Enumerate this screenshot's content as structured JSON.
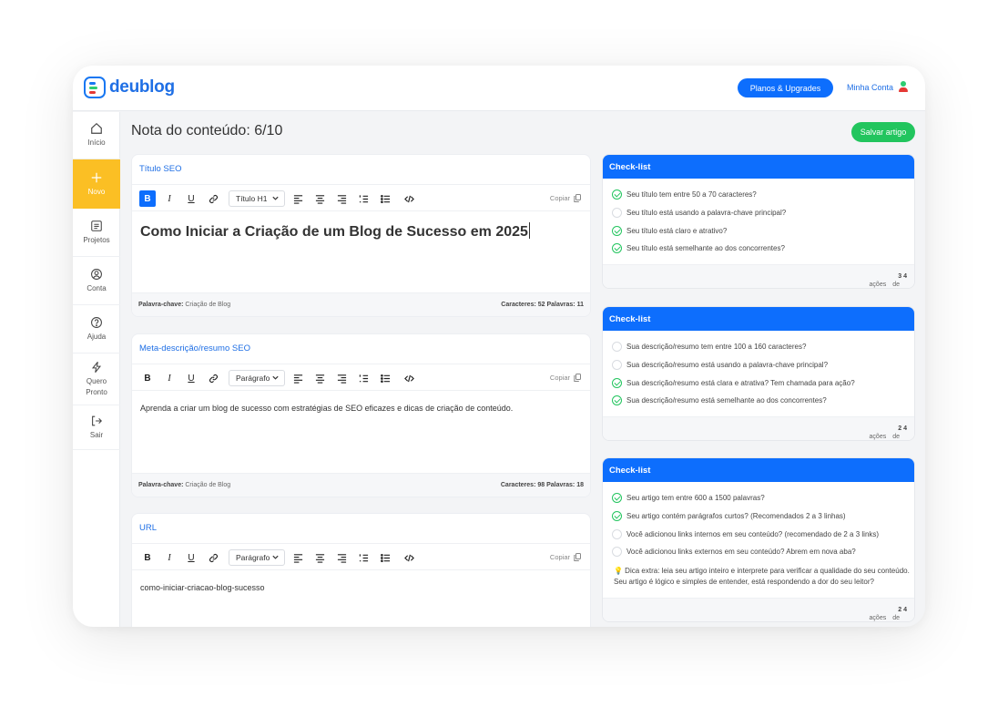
{
  "header": {
    "logo_text": "deublog",
    "plans_button": "Planos & Upgrades",
    "account_label": "Minha Conta"
  },
  "sidebar": {
    "items": [
      {
        "label": "Início",
        "icon": "home-icon"
      },
      {
        "label": "Novo",
        "icon": "plus-icon",
        "active": true
      },
      {
        "label": "Projetos",
        "icon": "list-icon"
      },
      {
        "label": "Conta",
        "icon": "user-icon"
      },
      {
        "label": "Ajuda",
        "icon": "help-icon"
      },
      {
        "label": "Quero Pronto",
        "icon": "bolt-icon"
      },
      {
        "label": "Sair",
        "icon": "logout-icon"
      }
    ]
  },
  "main": {
    "title": "Nota do conteúdo: 6/10",
    "save_button": "Salvar artigo"
  },
  "toolbar": {
    "bold": "B",
    "italic": "I",
    "underline": "U",
    "copy_label": "Copiar"
  },
  "editors": {
    "seo_title": {
      "label": "Título SEO",
      "format": "Título H1",
      "content": "Como Iniciar a Criação de um Blog de Sucesso em 2025",
      "keyword_label": "Palavra-chave:",
      "keyword": "Criação de Blog",
      "stats_chars_label": "Caracteres:",
      "chars": "52",
      "stats_words_label": "Palavras:",
      "words": "11"
    },
    "meta": {
      "label": "Meta-descrição/resumo SEO",
      "format": "Parágrafo",
      "content": "Aprenda a criar um blog de sucesso com estratégias de SEO eficazes e dicas de criação de conteúdo.",
      "keyword_label": "Palavra-chave:",
      "keyword": "Criação de Blog",
      "stats_chars_label": "Caracteres:",
      "chars": "98",
      "stats_words_label": "Palavras:",
      "words": "18"
    },
    "url": {
      "label": "URL",
      "format": "Parágrafo",
      "content": "como-iniciar-criacao-blog-sucesso"
    }
  },
  "checklists": [
    {
      "title": "Check-list",
      "items": [
        {
          "text": "Seu título tem entre 50 a 70 caracteres?",
          "done": true
        },
        {
          "text": "Seu título está usando a palavra-chave principal?",
          "done": false
        },
        {
          "text": "Seu título está claro e atrativo?",
          "done": true
        },
        {
          "text": "Seu título está semelhante ao dos concorrentes?",
          "done": true
        }
      ],
      "done_count": "3",
      "of_word": "de",
      "total": "4",
      "suffix": "ações concluídas"
    },
    {
      "title": "Check-list",
      "items": [
        {
          "text": "Sua descrição/resumo tem entre 100 a 160 caracteres?",
          "done": false
        },
        {
          "text": "Sua descrição/resumo está usando a palavra-chave principal?",
          "done": false
        },
        {
          "text": "Sua descrição/resumo está clara e atrativa? Tem chamada para ação?",
          "done": true
        },
        {
          "text": "Sua descrição/resumo está semelhante ao dos concorrentes?",
          "done": true
        }
      ],
      "done_count": "2",
      "of_word": "de",
      "total": "4",
      "suffix": "ações concluídas"
    },
    {
      "title": "Check-list",
      "items": [
        {
          "text": "Seu artigo tem entre 600 a 1500 palavras?",
          "done": true
        },
        {
          "text": "Seu artigo contém parágrafos curtos? (Recomendados 2 a 3 linhas)",
          "done": true
        },
        {
          "text": "Você adicionou links internos em seu conteúdo? (recomendado de 2 a 3 links)",
          "done": false
        },
        {
          "text": "Você adicionou links externos em seu conteúdo? Abrem em nova aba?",
          "done": false
        }
      ],
      "extra_tip": "💡 Dica extra: leia seu artigo inteiro e interprete para verificar a qualidade do seu conteúdo. Seu artigo é lógico e simples de entender, está respondendo a dor do seu leitor?",
      "done_count": "2",
      "of_word": "de",
      "total": "4",
      "suffix": "ações concluídas"
    }
  ],
  "colors": {
    "primary": "#0d6efd",
    "brand_blue": "#1f6fe5",
    "success": "#22c55e",
    "active_nav": "#fbbf24",
    "logo_red": "#e53935"
  }
}
